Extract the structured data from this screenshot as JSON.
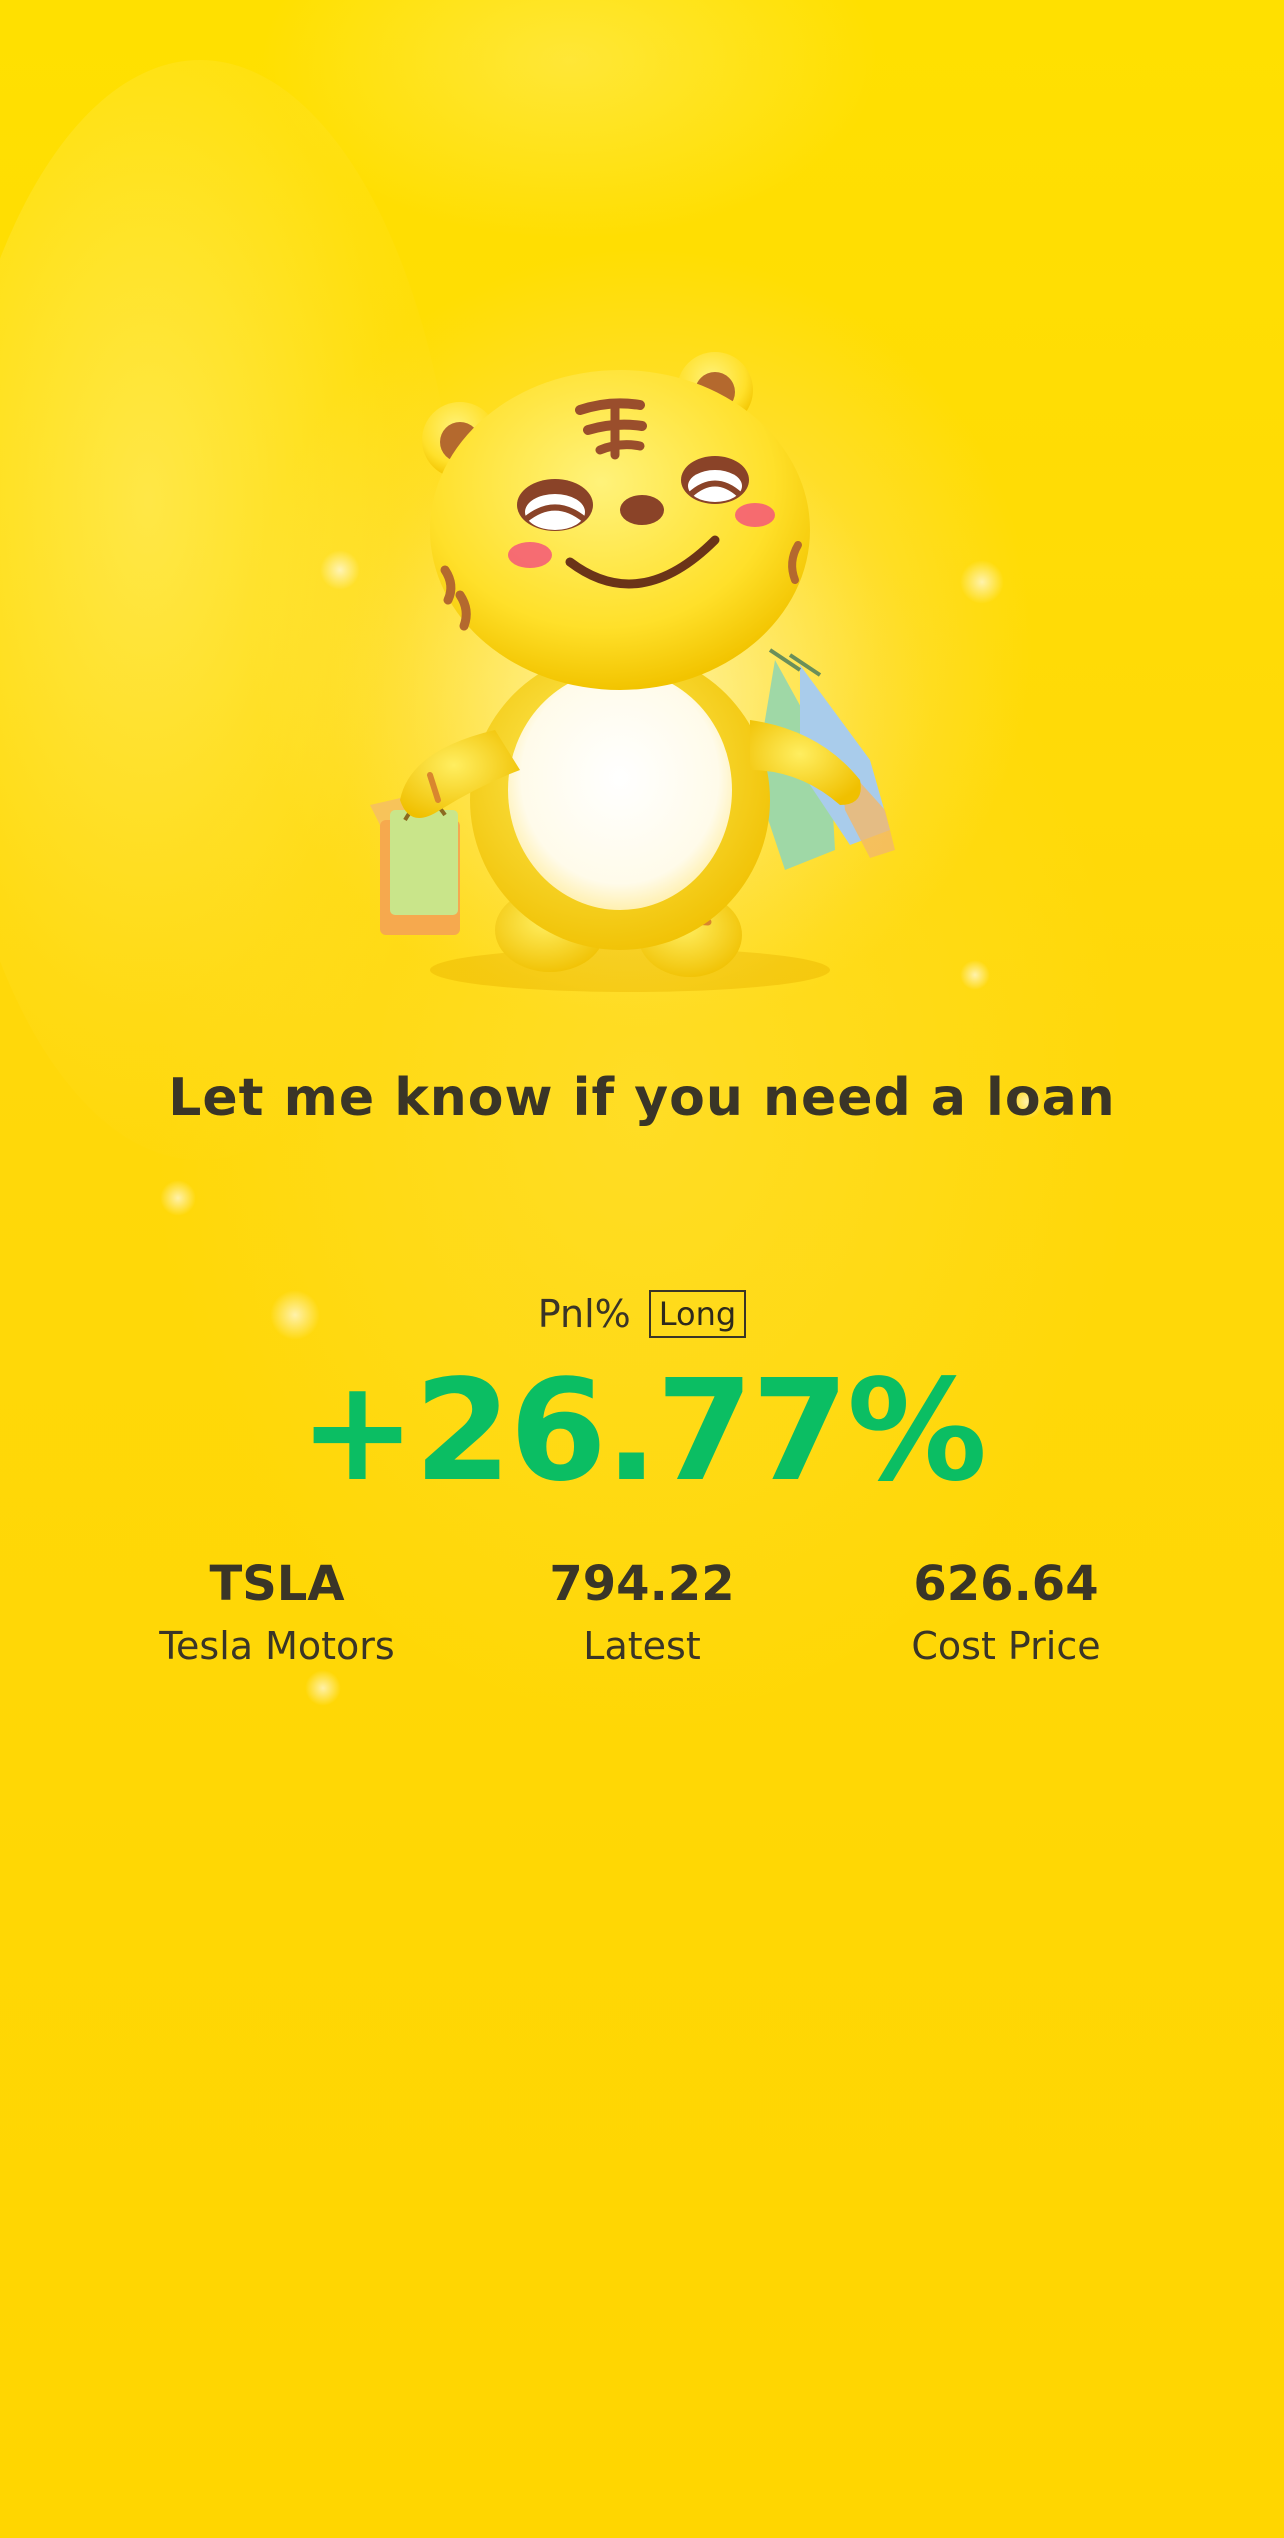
{
  "slogan": "Let me know if you need a loan",
  "pnl": {
    "label": "Pnl%",
    "badge": "Long",
    "value": "+26.77%"
  },
  "stats": [
    {
      "main": "TSLA",
      "sub": "Tesla Motors"
    },
    {
      "main": "794.22",
      "sub": "Latest"
    },
    {
      "main": "626.64",
      "sub": "Cost Price"
    }
  ],
  "mascot": {
    "icon": "tiger-mascot-icon"
  },
  "colors": {
    "background": "#FFD600",
    "positive": "#0BBE63",
    "text": "#3a3527"
  }
}
